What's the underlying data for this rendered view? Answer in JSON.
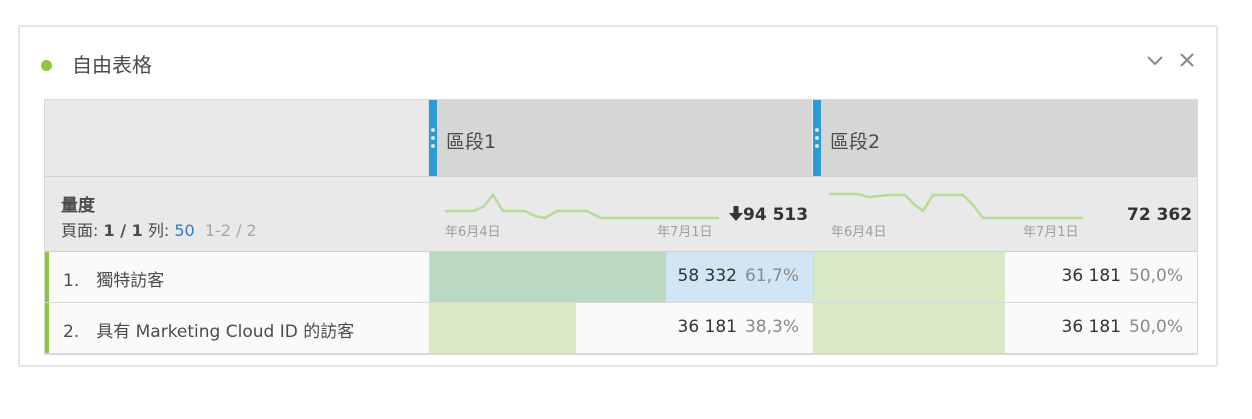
{
  "panel": {
    "title": "自由表格",
    "status_color": "#8ec63f"
  },
  "controls": {
    "collapse_icon": "chevron-down-icon",
    "close_icon": "close-icon"
  },
  "segments": [
    {
      "label": "區段1"
    },
    {
      "label": "區段2"
    }
  ],
  "metric": {
    "title": "量度",
    "pager_prefix": "頁面: ",
    "pager_value": "1 / 1",
    "rows_prefix": " 列: ",
    "rows_value": "50",
    "range": "1-2 / 2"
  },
  "summary": [
    {
      "total": "94 513",
      "trend": "down",
      "date_start": "年6月4日",
      "date_end": "年7月1日"
    },
    {
      "total": "72 362",
      "date_start": "年6月4日",
      "date_end": "年7月1日"
    }
  ],
  "rows": [
    {
      "label": "1.　獨特訪客",
      "cells": [
        {
          "value": "58 332",
          "pct": "61,7%",
          "share": 0.617
        },
        {
          "value": "36 181",
          "pct": "50,0%",
          "share": 0.5
        }
      ]
    },
    {
      "label": "2.　具有 Marketing Cloud ID 的訪客",
      "cells": [
        {
          "value": "36 181",
          "pct": "38,3%",
          "share": 0.383
        },
        {
          "value": "36 181",
          "pct": "50,0%",
          "share": 0.5
        }
      ]
    }
  ],
  "colors": {
    "bar_highlight": "#bcd9c2",
    "bar_normal": "#d8eac5",
    "cell_highlight": "#d1e5f4",
    "segment_handle": "#2d9ad6",
    "sparkline": "#b6dc94"
  }
}
